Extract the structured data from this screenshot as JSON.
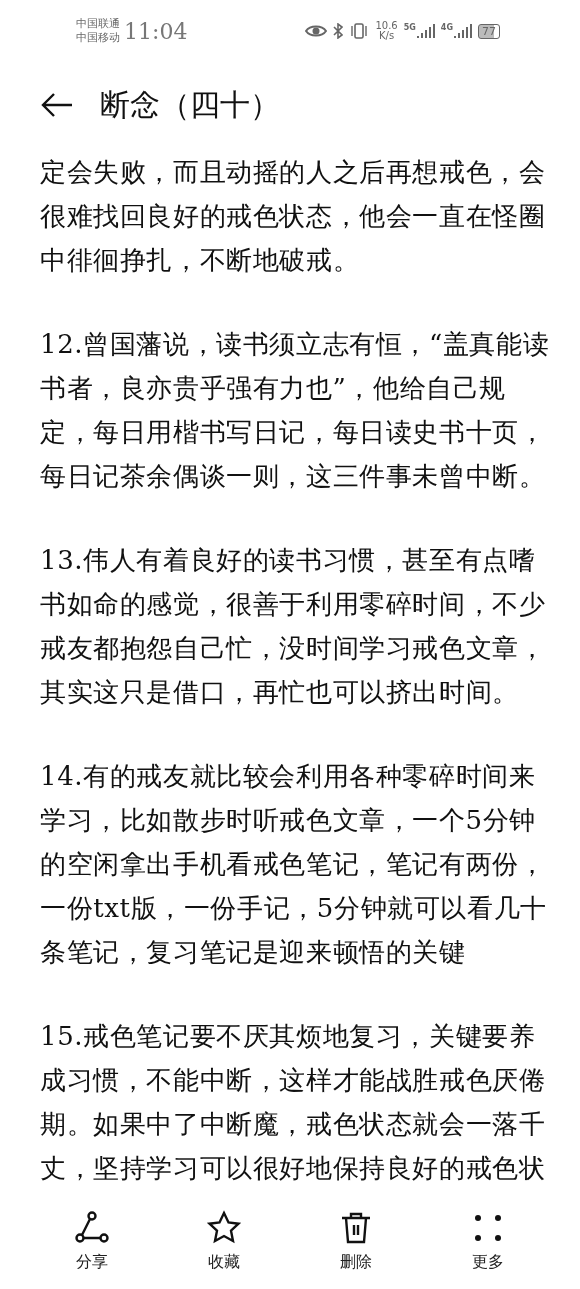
{
  "status_bar": {
    "carriers": [
      "中国联通",
      "中国移动"
    ],
    "time": "11:04",
    "net_speed": [
      "10.6",
      "K/s"
    ],
    "signals": [
      "5G",
      "4G"
    ],
    "battery": "77"
  },
  "header": {
    "title": "断念（四十）"
  },
  "paragraphs": [
    "定会失败，而且动摇的人之后再想戒色，会很难找回良好的戒色状态，他会一直在怪圈中徘徊挣扎，不断地破戒。",
    "12.曾国藩说，读书须立志有恒，“盖真能读书者，良亦贵乎强有力也”，他给自己规定，每日用楷书写日记，每日读史书十页，每日记茶余偶谈一则，这三件事未曾中断。",
    "13.伟人有着良好的读书习惯，甚至有点嗜书如命的感觉，很善于利用零碎时间，不少戒友都抱怨自己忙，没时间学习戒色文章，其实这只是借口，再忙也可以挤出时间。",
    "14.有的戒友就比较会利用各种零碎时间来学习，比如散步时听戒色文章，一个5分钟的空闲拿出手机看戒色笔记，笔记有两份，一份txt版，一份手记，5分钟就可以看几十条笔记，复习笔记是迎来顿悟的关键",
    "15.戒色笔记要不厌其烦地复习，关键要养成习惯，不能中断，这样才能战胜戒色厌倦期。如果中了中断魔，戒色状态就会一落千丈，坚持学习可以很好地保持良好的戒色状"
  ],
  "toolbar": [
    {
      "kind": "share",
      "label": "分享"
    },
    {
      "kind": "star",
      "label": "收藏"
    },
    {
      "kind": "delete",
      "label": "删除"
    },
    {
      "kind": "more",
      "label": "更多"
    }
  ]
}
